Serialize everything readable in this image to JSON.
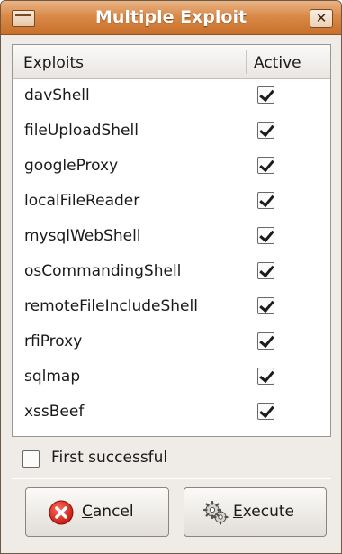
{
  "window": {
    "title": "Multiple Exploit"
  },
  "list": {
    "headers": {
      "exploits": "Exploits",
      "active": "Active"
    },
    "rows": [
      {
        "label": "davShell",
        "checked": true
      },
      {
        "label": "fileUploadShell",
        "checked": true
      },
      {
        "label": "googleProxy",
        "checked": true
      },
      {
        "label": "localFileReader",
        "checked": true
      },
      {
        "label": "mysqlWebShell",
        "checked": true
      },
      {
        "label": "osCommandingShell",
        "checked": true
      },
      {
        "label": "remoteFileIncludeShell",
        "checked": true
      },
      {
        "label": "rfiProxy",
        "checked": true
      },
      {
        "label": "sqlmap",
        "checked": true
      },
      {
        "label": "xssBeef",
        "checked": true
      }
    ]
  },
  "options": {
    "first_successful_label": "First successful",
    "first_successful_checked": false
  },
  "buttons": {
    "cancel": {
      "mnemonic": "C",
      "rest": "ancel",
      "icon": "cancel-icon"
    },
    "execute": {
      "mnemonic": "E",
      "rest": "xecute",
      "icon": "gears-icon"
    }
  },
  "colors": {
    "titlebar": "#d98a49",
    "window_bg": "#efebe7",
    "cancel_icon": "#d9261c"
  }
}
